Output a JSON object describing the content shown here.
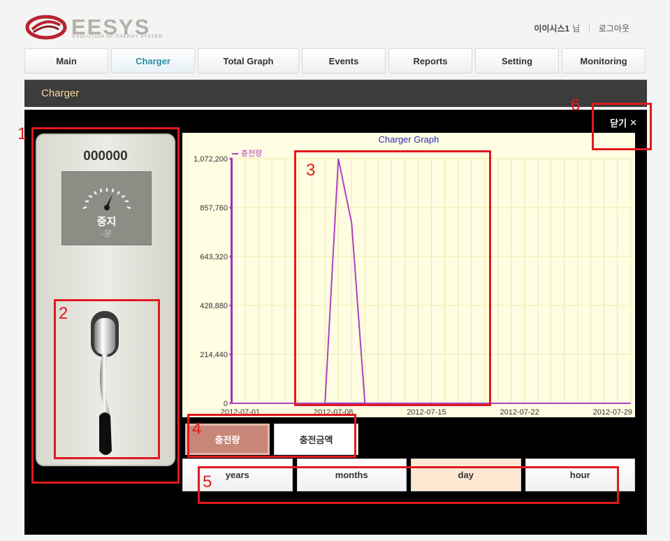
{
  "header": {
    "logo_text": "EESYS",
    "logo_tagline": "EVOLUTION OF ENERGY SYSTEM",
    "user_name": "이이시스1",
    "user_suffix": "님",
    "logout": "로그아웃"
  },
  "nav": {
    "tabs": [
      {
        "label": "Main",
        "active": false
      },
      {
        "label": "Charger",
        "active": true
      },
      {
        "label": "Total Graph",
        "active": false
      },
      {
        "label": "Events",
        "active": false
      },
      {
        "label": "Reports",
        "active": false
      },
      {
        "label": "Setting",
        "active": false
      },
      {
        "label": "Monitoring",
        "active": false
      }
    ]
  },
  "page": {
    "title": "Charger",
    "close_label": "닫기",
    "close_icon": "close-icon"
  },
  "charger": {
    "code": "000000",
    "status": "중지",
    "duration": "-분",
    "gauge_icon": "gauge-icon",
    "plug_icon": "charging-plug-icon"
  },
  "chart_data": {
    "type": "line",
    "title": "Charger Graph",
    "legend": "충전량",
    "legend_position": "top-left",
    "y_ticks": [
      "0",
      "214,440",
      "428,880",
      "643,320",
      "857,760",
      "1,072,200"
    ],
    "x_ticks": [
      "2012-07-01",
      "2012-07-08",
      "2012-07-15",
      "2012-07-22",
      "2012-07-29"
    ],
    "ylim": [
      0,
      1072200
    ],
    "grid": true,
    "series": [
      {
        "name": "충전량",
        "color": "#b040c0",
        "x": [
          "2012-07-01",
          "2012-07-02",
          "2012-07-03",
          "2012-07-04",
          "2012-07-05",
          "2012-07-06",
          "2012-07-07",
          "2012-07-08",
          "2012-07-09",
          "2012-07-10",
          "2012-07-11",
          "2012-07-12",
          "2012-07-13",
          "2012-07-14",
          "2012-07-15",
          "2012-07-16",
          "2012-07-17",
          "2012-07-18",
          "2012-07-19",
          "2012-07-20",
          "2012-07-21",
          "2012-07-22",
          "2012-07-23",
          "2012-07-24",
          "2012-07-25",
          "2012-07-26",
          "2012-07-27",
          "2012-07-28",
          "2012-07-29",
          "2012-07-30",
          "2012-07-31"
        ],
        "values": [
          0,
          0,
          0,
          0,
          0,
          0,
          0,
          0,
          1072200,
          790000,
          0,
          0,
          0,
          0,
          0,
          0,
          0,
          0,
          0,
          0,
          0,
          0,
          0,
          0,
          0,
          0,
          0,
          0,
          0,
          0,
          0
        ]
      }
    ]
  },
  "controls": {
    "metric_buttons": [
      {
        "label": "충전량",
        "active": true
      },
      {
        "label": "충전금액",
        "active": false
      }
    ],
    "range_buttons": [
      {
        "label": "years",
        "active": false
      },
      {
        "label": "months",
        "active": false
      },
      {
        "label": "day",
        "active": true
      },
      {
        "label": "hour",
        "active": false
      }
    ]
  },
  "annotations": [
    "1",
    "2",
    "3",
    "4",
    "5",
    "6"
  ],
  "colors": {
    "accent": "#2a8fa8",
    "title_text": "#f5d89a",
    "annotation": "#e0191e",
    "active_metric": "#c88679",
    "active_range": "#fde8d2"
  }
}
